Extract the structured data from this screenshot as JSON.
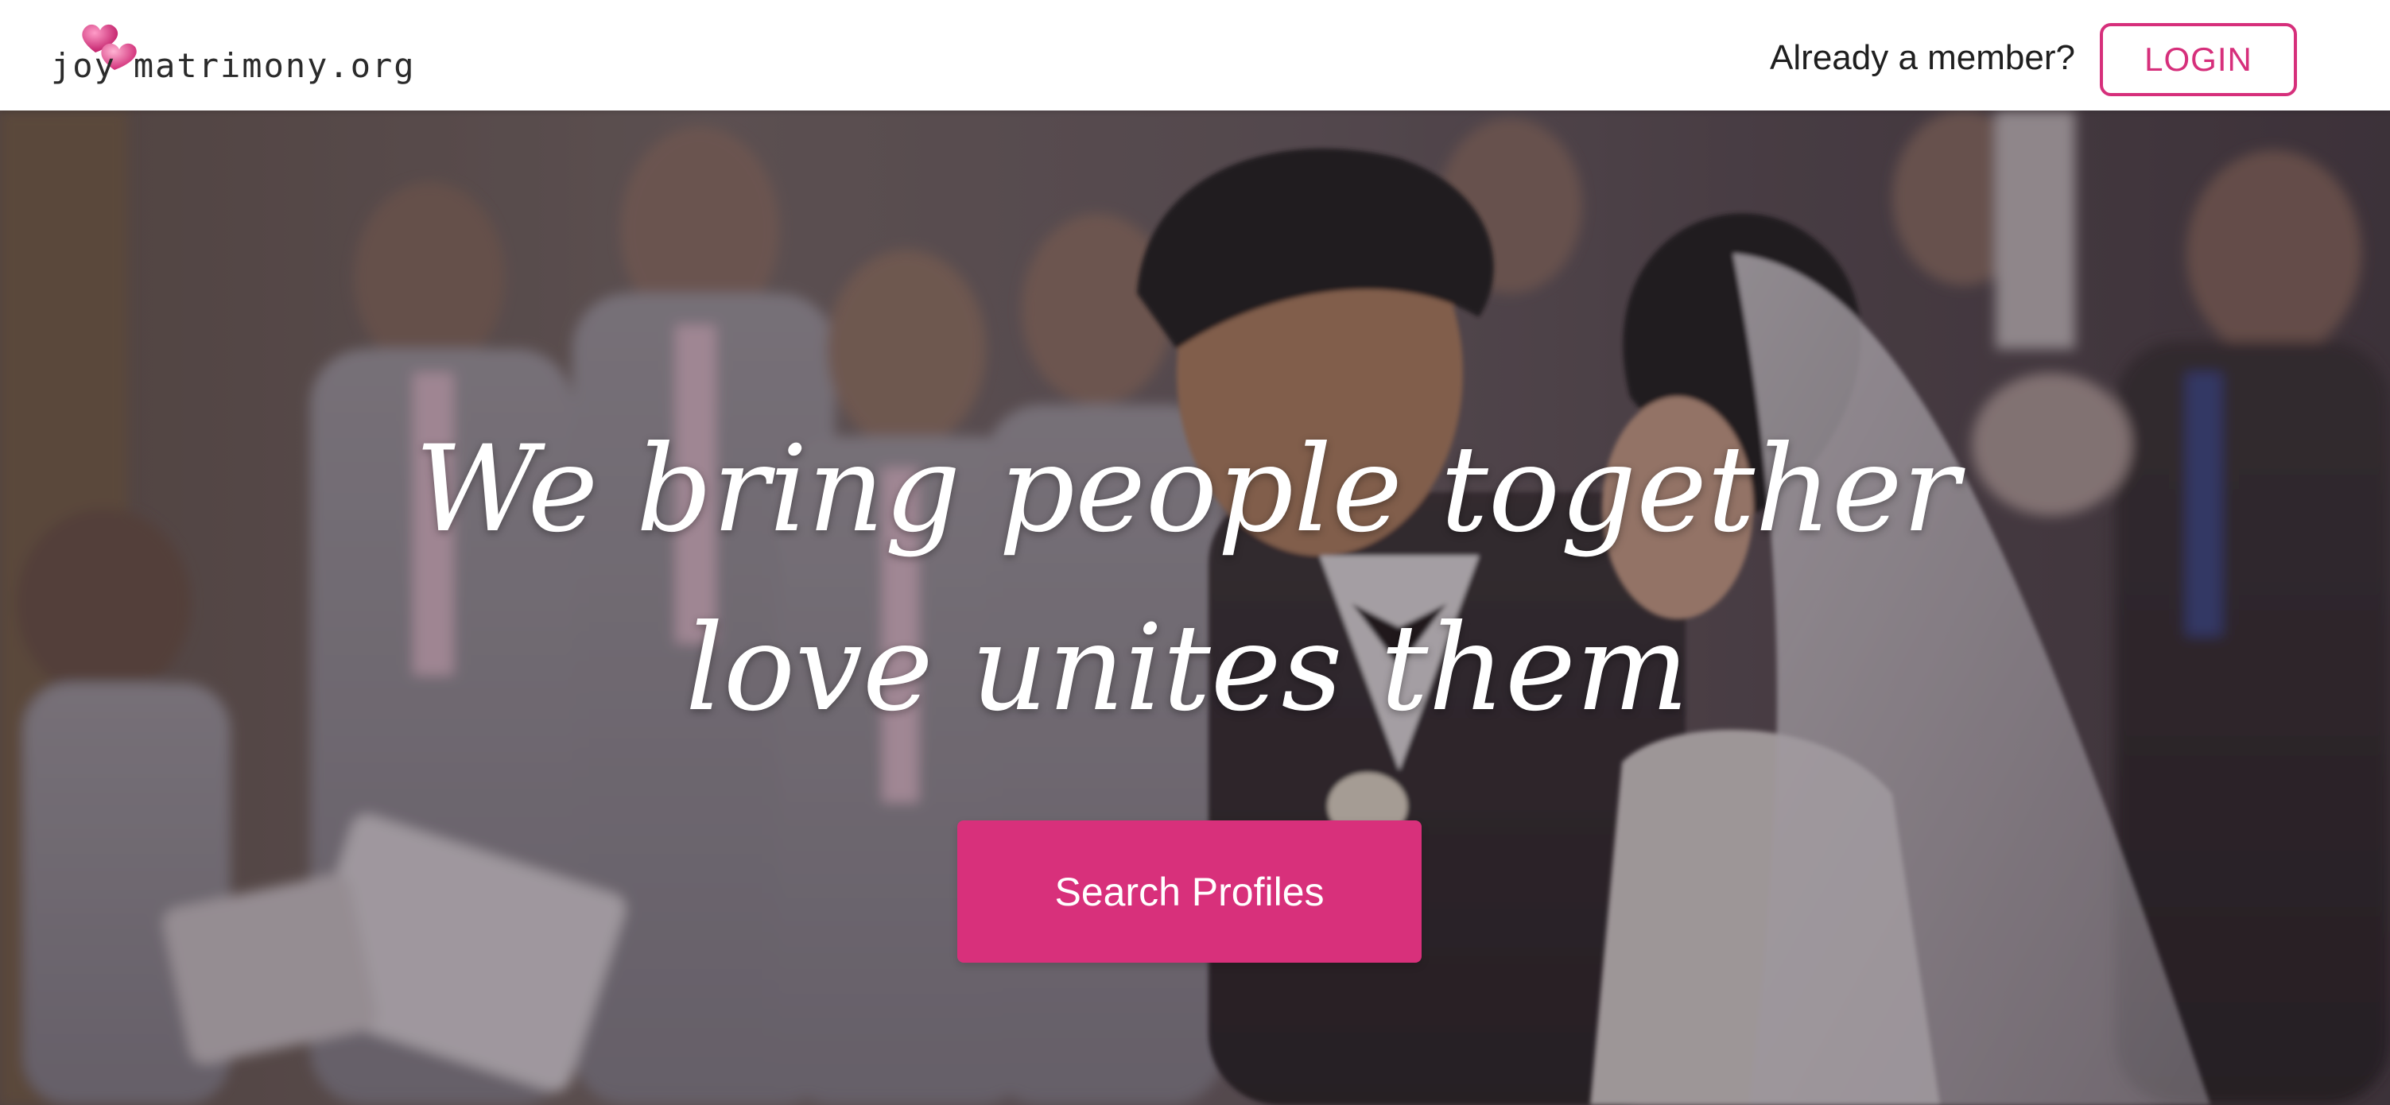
{
  "brand": {
    "logo_left": "joy",
    "logo_right": "matrimony.org",
    "accent_color": "#d62f7b"
  },
  "header": {
    "member_prompt": "Already a member?",
    "login_label": "LOGIN"
  },
  "hero": {
    "headline_line1": "We bring people together",
    "headline_line2": "love unites them",
    "cta_label": "Search Profiles",
    "cta_color": "#d8307b",
    "background_image": "wedding-ceremony-photo"
  }
}
